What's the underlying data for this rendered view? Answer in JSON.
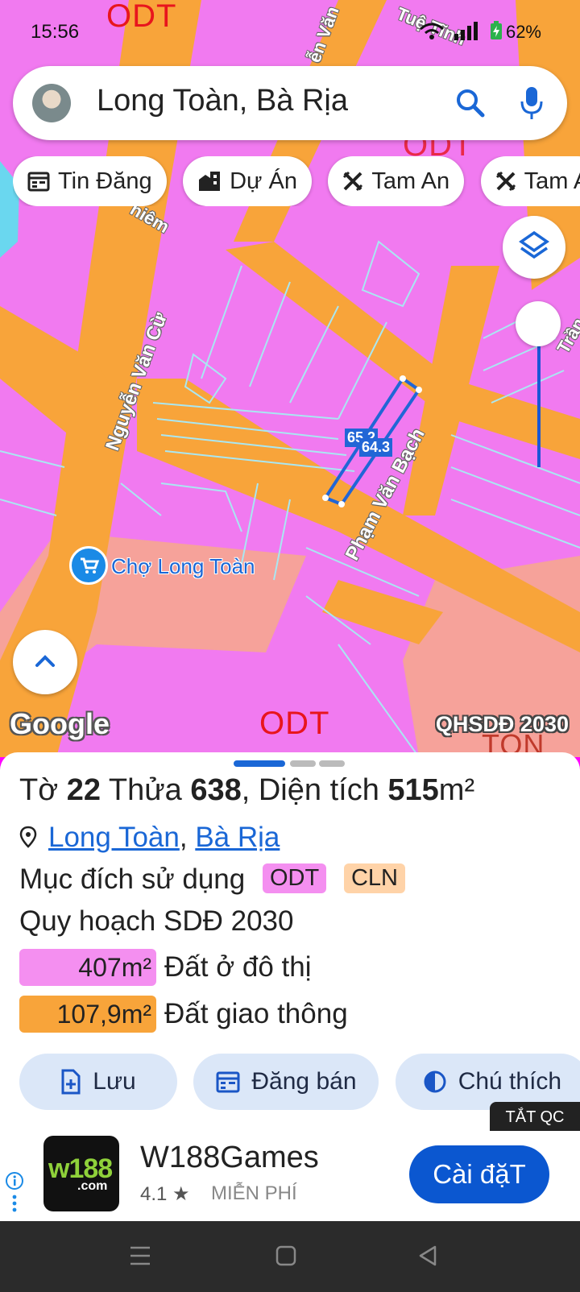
{
  "status_bar": {
    "time": "15:56",
    "battery": "62%"
  },
  "search": {
    "query": "Long Toàn, Bà Rịa"
  },
  "chips": [
    {
      "label": "Tin Đăng",
      "icon": "calendar-icon"
    },
    {
      "label": "Dự Án",
      "icon": "building-icon"
    },
    {
      "label": "Tam An",
      "icon": "pencil-ruler-icon"
    },
    {
      "label": "Tam A",
      "icon": "pencil-ruler-icon"
    }
  ],
  "map": {
    "zone_labels": [
      "ODT",
      "ODT",
      "ODT",
      "TON"
    ],
    "streets": [
      "Nguyễn Văn Cừ",
      "Phạm Văn Bạch",
      "Tuệ Tĩnh",
      "ễn Văn",
      "hiêm",
      "Trần"
    ],
    "poi": "Chợ Long Toàn",
    "dimensions": [
      "65.2",
      "64.3"
    ],
    "attribution": "Google",
    "layer_name": "QHSDĐ 2030"
  },
  "parcel": {
    "sheet_label": "Tờ",
    "sheet_no": "22",
    "plot_label": "Thửa",
    "plot_no": "638",
    "area_label": ", Diện tích",
    "area_value": "515",
    "area_unit": "m²",
    "ward": "Long Toàn",
    "city": "Bà Rịa",
    "purpose_label": "Mục đích sử dụng",
    "purpose_tags": [
      {
        "code": "ODT",
        "color": "#f48ff0"
      },
      {
        "code": "CLN",
        "color": "#ffd3a8"
      }
    ],
    "plan_label": "Quy hoạch SDĐ 2030",
    "land_uses": [
      {
        "area": "407m²",
        "label": "Đất ở đô thị",
        "color": "#f48ff0"
      },
      {
        "area": "107,9m²",
        "label": "Đất giao thông",
        "color": "#f8a43a"
      }
    ]
  },
  "actions": [
    {
      "label": "Lưu",
      "icon": "save-doc-icon"
    },
    {
      "label": "Đăng bán",
      "icon": "calendar-post-icon"
    },
    {
      "label": "Chú thích",
      "icon": "contrast-icon"
    }
  ],
  "ad": {
    "hide_label": "TẮT QC",
    "logo_text": "w188",
    "logo_sub": ".com",
    "app_name": "W188Games",
    "rating": "4.1 ★",
    "price": "MIỄN PHÍ",
    "install_label": "Cài đặT"
  },
  "colors": {
    "accent": "#1a67d6",
    "urban_zone": "#f17af0",
    "road": "#f8a43a",
    "button_bg": "#dbe7f8",
    "install": "#0b57d0"
  }
}
